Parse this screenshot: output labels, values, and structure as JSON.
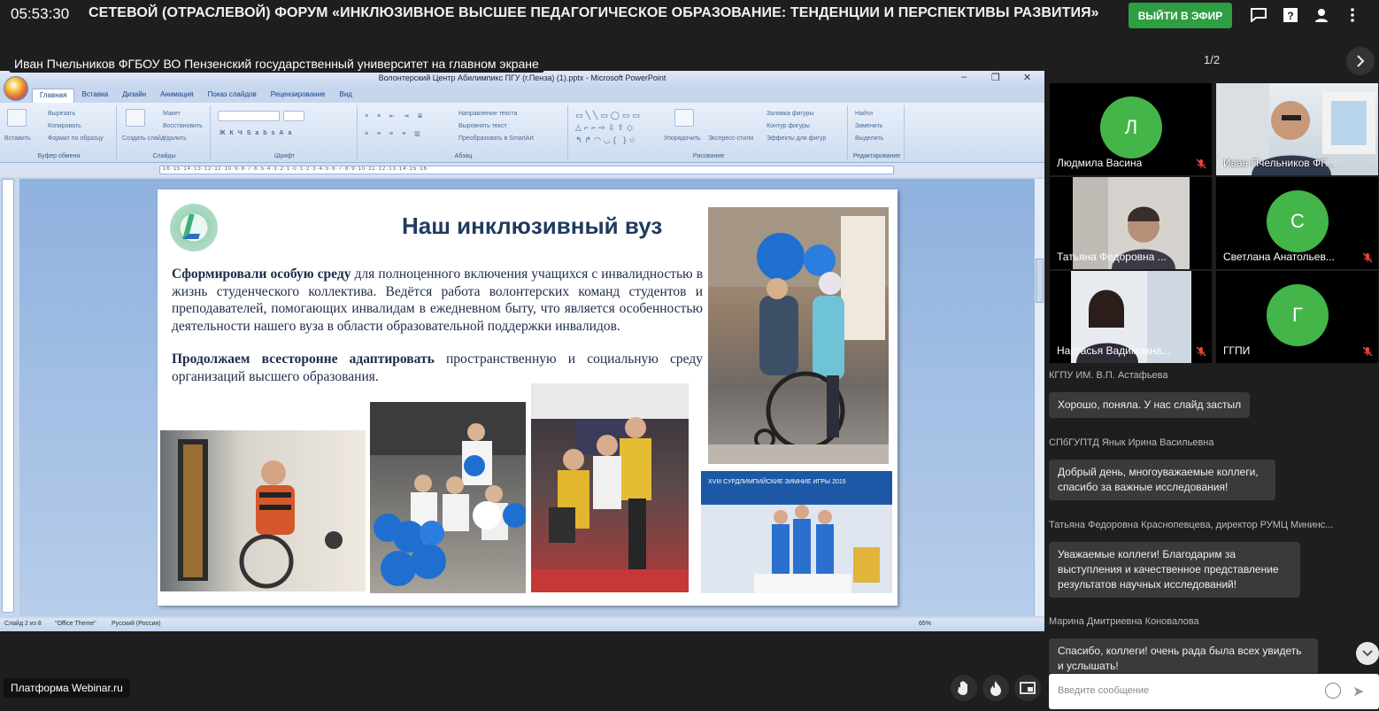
{
  "header": {
    "clock": "05:53:30",
    "event_title": "СЕТЕВОЙ (ОТРАСЛЕВОЙ) ФОРУМ «ИНКЛЮЗИВНОЕ ВЫСШЕЕ ПЕДАГОГИЧЕСКОЕ ОБРАЗОВАНИЕ: ТЕНДЕНЦИИ И ПЕРСПЕКТИВЫ РАЗВИТИЯ»",
    "leave_button": "ВЫЙТИ В ЭФИР",
    "icons": [
      "chat-icon",
      "help-icon",
      "user-icon",
      "more-icon"
    ]
  },
  "stage": {
    "presenter_caption": "Иван Пчельников ФГБОУ ВО Пензенский государственный университет на главном экране"
  },
  "ppt": {
    "window_title": "Волонтерский Центр Абилимпикс ПГУ (г.Пенза) (1).pptx - Microsoft PowerPoint",
    "tabs": [
      "Главная",
      "Вставка",
      "Дизайн",
      "Анимация",
      "Показ слайдов",
      "Рецензирование",
      "Вид"
    ],
    "groups": [
      "Буфер обмена",
      "Слайды",
      "Шрифт",
      "Абзац",
      "Рисование",
      "Редактирование"
    ],
    "clipboard": {
      "paste": "Вставить",
      "cut": "Вырезать",
      "copy": "Копировать",
      "format": "Формат по образцу"
    },
    "slides": {
      "create": "Создать слайд",
      "layout": "Макет",
      "reset": "Восстановить",
      "delete": "Удалить"
    },
    "paragraph": {
      "direction": "Направление текста",
      "align": "Выровнять текст",
      "smartart": "Преобразовать в SmartArt"
    },
    "drawing": {
      "arrange": "Упорядочить",
      "styles": "Экспресс-стили",
      "fill": "Заливка фигуры",
      "outline": "Контур фигуры",
      "effects": "Эффекты для фигур"
    },
    "editing": {
      "find": "Найти",
      "replace": "Заменить",
      "select": "Выделить"
    },
    "ruler_text": "·16·15·14·13·12·11·10·9·8·7·6·5·4·3·2·1·0·1·2·3·4·5·6·7·8·9·10·11·12·13·14·15·16·",
    "status": {
      "slide": "Слайд 2 из 8",
      "theme": "\"Office Theme\"",
      "language": "Русский (Россия)",
      "zoom": "65%"
    }
  },
  "slide": {
    "heading": "Наш инклюзивный вуз",
    "p1_bold": "Сформировали особую среду",
    "p1_rest": " для полноценного включения учащихся с инвалидностью в жизнь студенческого коллектива. Ведётся работа волонтерских команд студентов и преподавателей, помогающих инвалидам в ежедневном быту, что является особенностью деятельности нашего вуза в области образовательной поддержки инвалидов.",
    "p2_bold": "Продолжаем всесторонне адаптировать",
    "p2_rest": " пространственную и социальную среду организаций высшего образования.",
    "poster_text": "XVIII СУРДЛИМПИЙСКИЕ ЗИМНИЕ ИГРЫ 2015"
  },
  "participants": {
    "counter": "1/2",
    "tiles": [
      {
        "name": "Людмила Васина",
        "initial": "Л",
        "muted": true
      },
      {
        "name": "Иван Пчельников ФГ...",
        "initial": "",
        "muted": false
      },
      {
        "name": "Татьяна Федоровна ...",
        "initial": "",
        "muted": false
      },
      {
        "name": "Светлана Анатольев...",
        "initial": "С",
        "muted": true
      },
      {
        "name": "Настасья Вадимовна...",
        "initial": "",
        "muted": true
      },
      {
        "name": "ГГПИ",
        "initial": "Г",
        "muted": true
      }
    ]
  },
  "chat": {
    "messages": [
      {
        "author": "КГПУ ИМ. В.П. Астафьева",
        "text": ""
      },
      {
        "author": "",
        "text": "Хорошо, поняла. У нас слайд застыл"
      },
      {
        "author": "СПбГУПТД Янык Ирина Васильевна",
        "text": "Добрый день, многоуважаемые коллеги, спасибо за важные исследования!"
      },
      {
        "author": "Татьяна Федоровна Краснопевцева, директор РУМЦ Мининс...",
        "text": "Уважаемые коллеги! Благодарим за выступления и качественное представление результатов научных исследований!"
      },
      {
        "author": "Марина Дмитриевна Коновалова",
        "text": "Спасибо, коллеги! очень рада была всех увидеть и услышать!"
      }
    ],
    "input_placeholder": "Введите сообщение"
  },
  "footer": {
    "platform": "Платформа Webinar.ru"
  }
}
